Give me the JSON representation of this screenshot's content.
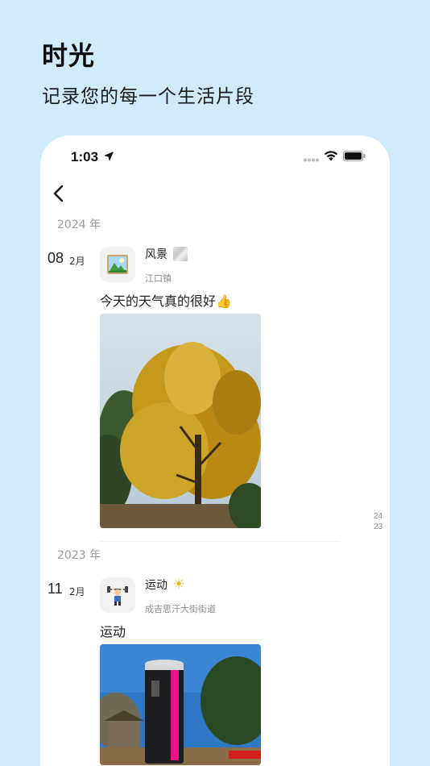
{
  "hero": {
    "title": "时光",
    "subtitle": "记录您的每一个生活片段"
  },
  "status_bar": {
    "time": "1:03"
  },
  "entries": [
    {
      "year": "2024 年",
      "day": "08",
      "month": "2月",
      "title": "风景",
      "location": "江口镇",
      "text": "今天的天气真的很好👍",
      "side_stat_top": "24",
      "side_stat_bottom": "23",
      "avatar_icon": "landscape-icon"
    },
    {
      "year": "2023 年",
      "day": "11",
      "month": "2月",
      "title": "运动",
      "title_emoji": "☀",
      "location": "成吉思汗大街街道",
      "text": "运动",
      "avatar_icon": "weightlifter-icon"
    }
  ],
  "colors": {
    "background": "#cfeaf8",
    "card": "#ffffff",
    "muted_text": "#9a9a9a"
  }
}
